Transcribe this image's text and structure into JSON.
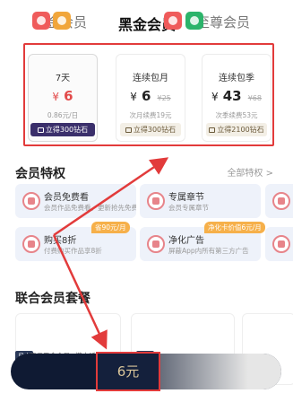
{
  "tabs": [
    {
      "label": "白金会员"
    },
    {
      "label": "黑金会员"
    },
    {
      "label": "至尊会员"
    }
  ],
  "plans": [
    {
      "title": "7天",
      "currency": "¥",
      "price": "6",
      "old_price": "",
      "sub": "0.86元/日",
      "button": "立得300钻石"
    },
    {
      "title": "连续包月",
      "currency": "¥",
      "price": "6",
      "old_price": "¥25",
      "sub": "次月续费19元",
      "button": "立得300钻石"
    },
    {
      "title": "连续包季",
      "currency": "¥",
      "price": "43",
      "old_price": "¥68",
      "sub": "次季续费53元",
      "button": "立得2100钻石"
    }
  ],
  "privileges": {
    "title": "会员特权",
    "all_link": "全部特权 >",
    "items": [
      {
        "name": "会员免费看",
        "desc": "会员作品免费看，更新抢先免费"
      },
      {
        "name": "专属章节",
        "desc": "会员专属章节"
      },
      {
        "name": "购买8折",
        "desc": "付费购买作品享8折"
      },
      {
        "name": "净化广告",
        "desc": "屏蔽App内所有第三方广告"
      }
    ],
    "badges": [
      "省90元/月",
      "净化卡价值6元/月"
    ]
  },
  "combo": {
    "title": "联合会员套餐",
    "tag": "月卡",
    "desc": "西瓜黑金会员+懒人听书"
  },
  "pay": {
    "price": "6元"
  },
  "colors": {
    "accent_red": "#e23b3b",
    "price_red": "#e24a4a",
    "dark_button": "#3a2f6b",
    "paybar_bg": "#0f1a33"
  }
}
